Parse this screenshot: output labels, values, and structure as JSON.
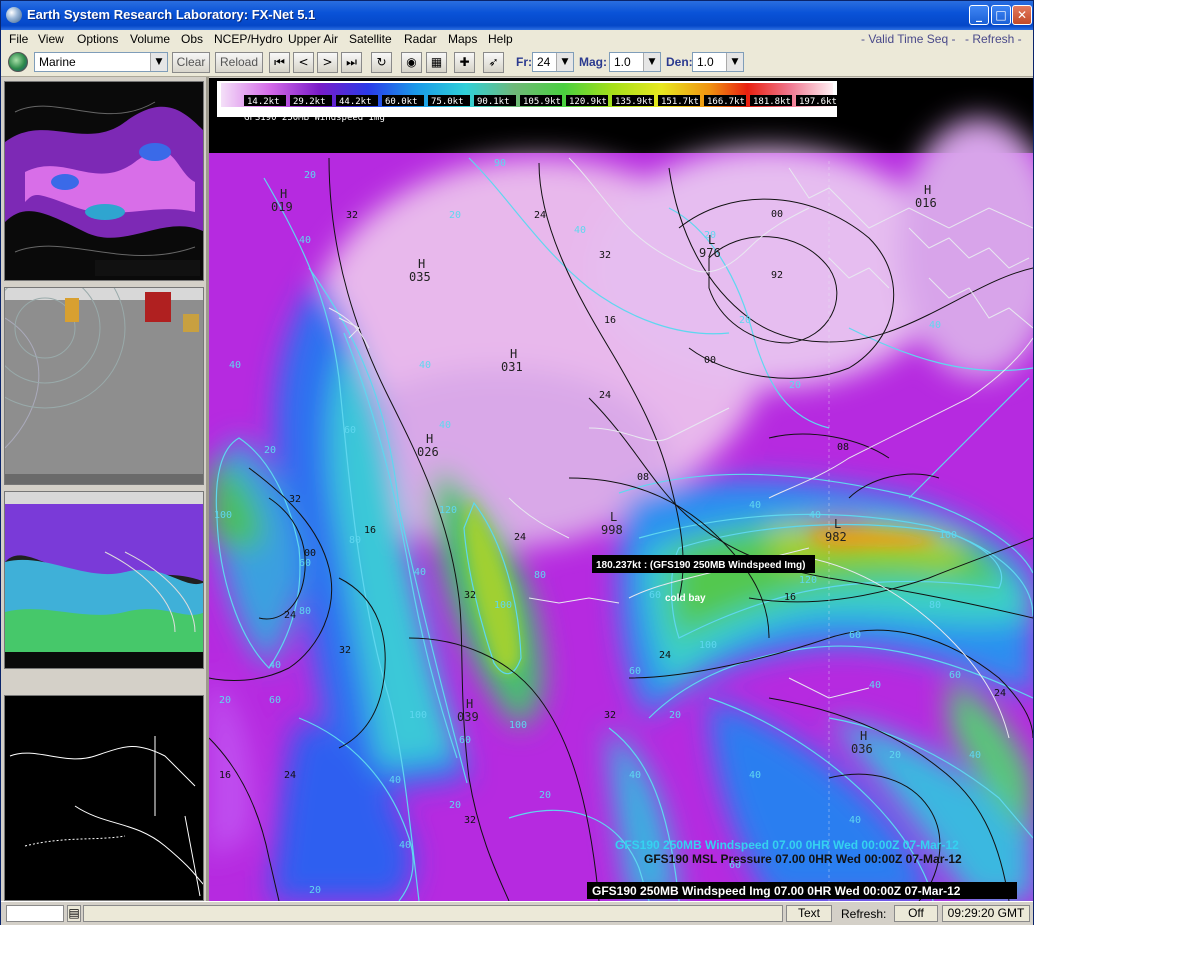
{
  "window": {
    "title": "Earth System Research Laboratory: FX-Net 5.1",
    "controls": {
      "minimize": "_",
      "maximize": "□",
      "close": "✕"
    }
  },
  "menu": {
    "items": [
      "File",
      "View",
      "Options",
      "Volume",
      "Obs",
      "NCEP/Hydro",
      "Upper Air",
      "Satellite",
      "Radar",
      "Maps",
      "Help"
    ],
    "valid_time_seq": "- Valid Time Seq -",
    "refresh": "- Refresh -"
  },
  "toolbar": {
    "region": "Marine",
    "clear": "Clear",
    "reload": "Reload",
    "nav_icons": [
      "first-frame-icon",
      "prev-frame-icon",
      "next-frame-icon",
      "last-frame-icon",
      "loop-icon"
    ],
    "fr_label": "Fr:",
    "fr_value": "24",
    "mag_label": "Mag:",
    "mag_value": "1.0",
    "den_label": "Den:",
    "den_value": "1.0"
  },
  "colorbar": {
    "labels": [
      "14.2kt",
      "29.2kt",
      "44.2kt",
      "60.0kt",
      "75.0kt",
      "90.1kt",
      "105.9kt",
      "120.9kt",
      "135.9kt",
      "151.7kt",
      "166.7kt",
      "181.8kt",
      "197.6kt"
    ],
    "product": "GFS190 250MB Windspeed Img"
  },
  "map": {
    "pressure_centers": [
      {
        "kind": "H",
        "value": "019"
      },
      {
        "kind": "H",
        "value": "035"
      },
      {
        "kind": "H",
        "value": "031"
      },
      {
        "kind": "H",
        "value": "026"
      },
      {
        "kind": "L",
        "value": "976"
      },
      {
        "kind": "H",
        "value": "016"
      },
      {
        "kind": "L",
        "value": "998"
      },
      {
        "kind": "L",
        "value": "982"
      },
      {
        "kind": "H",
        "value": "039"
      },
      {
        "kind": "H",
        "value": "036"
      }
    ],
    "probe_tooltip": "180.237kt : (GFS190 250MB Windspeed Img)",
    "station_label": "cold bay",
    "legend": [
      {
        "text": "GFS190 250MB Windspeed  07.00     0HR Wed 00:00Z 07-Mar-12",
        "color": "#35d2f0"
      },
      {
        "text": "GFS190 MSL Pressure  07.00     0HR Wed 00:00Z 07-Mar-12",
        "color": "#111111"
      },
      {
        "text": "GFS190 250MB Windspeed Img 07.00    0HR Wed 00:00Z 07-Mar-12",
        "color": "#ffffff"
      }
    ]
  },
  "status": {
    "text_btn": "Text",
    "refresh_label": "Refresh:",
    "refresh_value": "Off",
    "time": "09:29:20 GMT"
  },
  "colors": {
    "titlebar": "#0a53d8",
    "menubar": "#ece9d8",
    "map_background": "#000000",
    "contour_cyan": "#5fd7ef",
    "contour_black": "#111111",
    "accent_label": "#2b3a8f"
  }
}
